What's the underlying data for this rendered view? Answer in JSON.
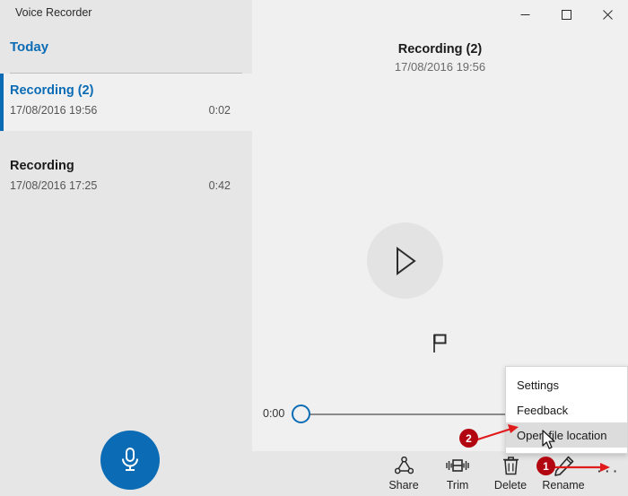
{
  "window": {
    "app_title": "Voice Recorder",
    "controls": {
      "minimize": "minimize-icon",
      "maximize": "maximize-icon",
      "close": "close-icon"
    }
  },
  "sidebar": {
    "group_label": "Today",
    "recordings": [
      {
        "name": "Recording (2)",
        "date": "17/08/2016 19:56",
        "duration": "0:02",
        "selected": true
      },
      {
        "name": "Recording",
        "date": "17/08/2016 17:25",
        "duration": "0:42",
        "selected": false
      }
    ],
    "record_button": "microphone-icon"
  },
  "main": {
    "title": "Recording (2)",
    "subtitle": "17/08/2016 19:56",
    "play_button": "play-icon",
    "flag_marker": "flag-icon",
    "timeline": {
      "current_time": "0:00",
      "position_percent": 0
    }
  },
  "toolbar": {
    "items": [
      {
        "label": "Share",
        "icon": "share-icon"
      },
      {
        "label": "Trim",
        "icon": "trim-icon"
      },
      {
        "label": "Delete",
        "icon": "trash-icon"
      },
      {
        "label": "Rename",
        "icon": "pencil-icon"
      }
    ],
    "more_label": "···"
  },
  "context_menu": {
    "items": [
      {
        "label": "Settings",
        "highlighted": false
      },
      {
        "label": "Feedback",
        "highlighted": false
      },
      {
        "label": "Open file location",
        "highlighted": true
      }
    ]
  },
  "annotations": {
    "badges": [
      {
        "number": "1",
        "points_to": "more-button"
      },
      {
        "number": "2",
        "points_to": "open-file-location-menu-item"
      }
    ],
    "badge_color": "#b20710",
    "arrow_color": "#e01b1b"
  },
  "colors": {
    "accent_blue": "#0b6cb5",
    "sidebar_bg": "#e6e6e6",
    "main_bg": "#f0f0f0",
    "menu_bg": "#ffffff",
    "menu_highlight": "#dcdcdc"
  }
}
